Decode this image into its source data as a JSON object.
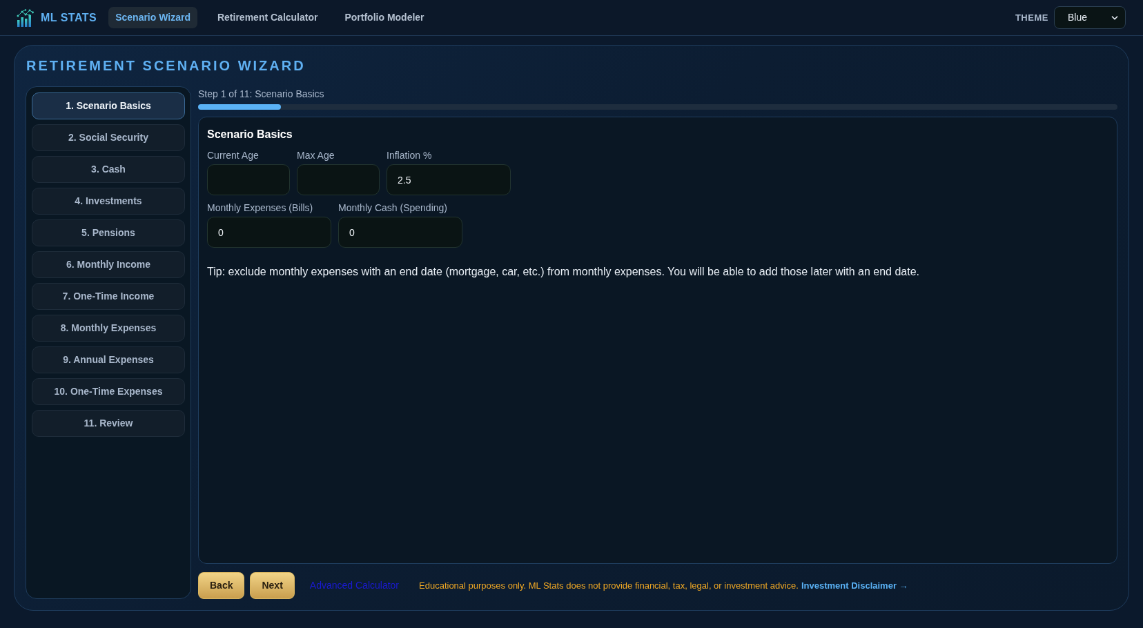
{
  "header": {
    "brand": "ML STATS",
    "nav": [
      {
        "label": "Scenario Wizard",
        "selected": true
      },
      {
        "label": "Retirement Calculator",
        "selected": false
      },
      {
        "label": "Portfolio Modeler",
        "selected": false
      }
    ],
    "theme": {
      "label": "THEME",
      "value": "Blue"
    }
  },
  "wizard": {
    "title": "RETIREMENT SCENARIO WIZARD",
    "steps": [
      {
        "label": "1. Scenario Basics",
        "selected": true
      },
      {
        "label": "2. Social Security",
        "selected": false
      },
      {
        "label": "3. Cash",
        "selected": false
      },
      {
        "label": "4. Investments",
        "selected": false
      },
      {
        "label": "5. Pensions",
        "selected": false
      },
      {
        "label": "6. Monthly Income",
        "selected": false
      },
      {
        "label": "7. One-Time Income",
        "selected": false
      },
      {
        "label": "8. Monthly Expenses",
        "selected": false
      },
      {
        "label": "9. Annual Expenses",
        "selected": false
      },
      {
        "label": "10. One-Time Expenses",
        "selected": false
      },
      {
        "label": "11. Review",
        "selected": false
      }
    ],
    "progress": {
      "text": "Step 1 of 11: Scenario Basics",
      "level": 0.09
    },
    "form": {
      "title": "Scenario Basics",
      "field_groups": [
        {
          "fields": [
            {
              "label": "Current Age"
            },
            {
              "label": "Max Age"
            },
            {
              "label": "Inflation %",
              "value": "2.5"
            }
          ]
        },
        {
          "fields": [
            {
              "label": "Monthly Expenses (Bills)",
              "value": "0"
            },
            {
              "label": "Monthly Cash (Spending)",
              "value": "0"
            }
          ]
        }
      ],
      "tip": "Tip: exclude monthly expenses with an end date (mortgage, car, etc.) from monthly expenses. You will be able to add those later with an end date."
    },
    "footer": {
      "buttons": [
        "Back",
        "Next"
      ],
      "link": "Advanced Calculator",
      "notice": "Educational purposes only. ML Stats does not provide financial, tax, legal, or investment advice.",
      "disclaimer_link": "Investment Disclaimer →"
    }
  }
}
